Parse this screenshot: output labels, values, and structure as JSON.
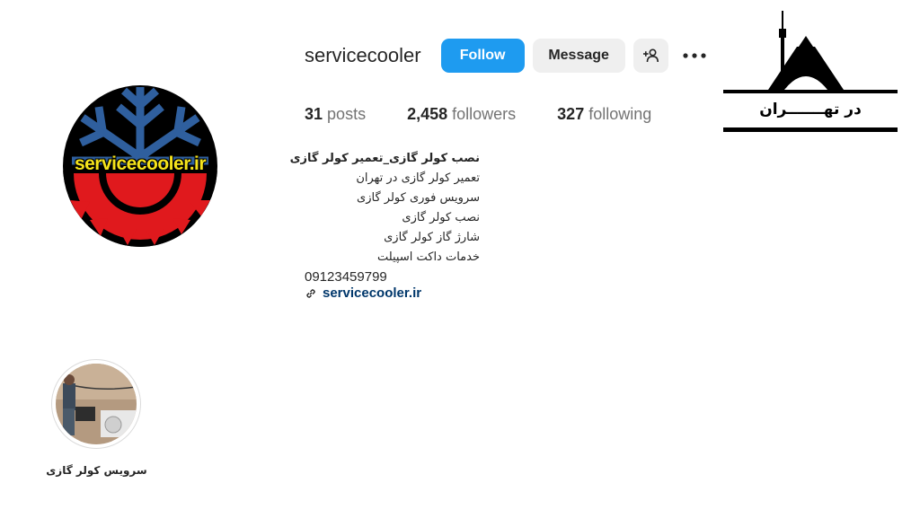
{
  "profile": {
    "username": "servicecooler",
    "avatar_text": "servicecooler.ir",
    "buttons": {
      "follow": "Follow",
      "message": "Message"
    },
    "stats": {
      "posts_count": "31",
      "posts_label": "posts",
      "followers_count": "2,458",
      "followers_label": "followers",
      "following_count": "327",
      "following_label": "following"
    },
    "bio": {
      "title": "نصب کولر گازی_تعمیر کولر گازی",
      "lines": [
        "تعمیر کولر گازی در تهران",
        "سرویس فوری کولر گازی",
        "نصب کولر گازی",
        "شارژ گاز کولر گازی",
        "خدمات داکت اسپیلت"
      ],
      "phone": "09123459799",
      "link": "servicecooler.ir"
    }
  },
  "highlights": [
    {
      "label": "سرویس کولر گازی"
    }
  ],
  "logo": {
    "text": "در تهـــــــران"
  },
  "icons": {
    "add_user": "add-person-icon",
    "more": "more-options-icon",
    "link": "link-icon",
    "avatar_snowflake": "snowflake-icon",
    "avatar_sun": "sun-icon",
    "logo_towers": "tehran-towers-icon"
  },
  "colors": {
    "follow_button": "#1e9bf0",
    "secondary_button": "#efefef",
    "link_text": "#00376b",
    "avatar_blue": "#2f5f9e",
    "avatar_red": "#e0191d",
    "avatar_text": "#f5e41c"
  }
}
